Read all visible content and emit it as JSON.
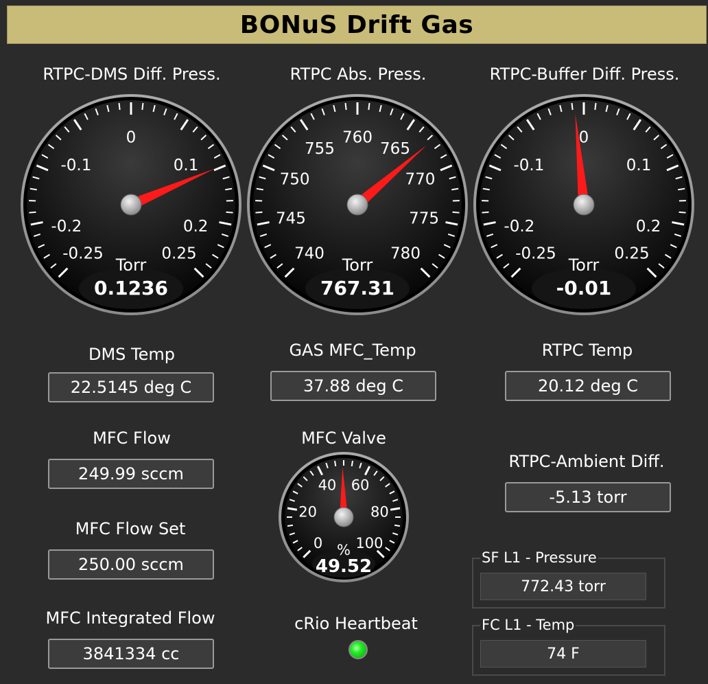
{
  "title": "BONuS Drift Gas",
  "gauges": {
    "dms": {
      "label": "RTPC-DMS Diff. Press.",
      "unit": "Torr",
      "display": "0.1236",
      "value": 0.1236,
      "ticks": [
        "-0.25",
        "-0.2",
        "-0.1",
        "0",
        "0.1",
        "0.2",
        "0.25"
      ],
      "range": [
        -0.25,
        0.25
      ],
      "tick_values": [
        -0.25,
        -0.2,
        -0.1,
        0,
        0.1,
        0.2,
        0.25
      ]
    },
    "abs": {
      "label": "RTPC Abs. Press.",
      "unit": "Torr",
      "display": "767.31",
      "value": 767.31,
      "ticks": [
        "740",
        "745",
        "750",
        "755",
        "760",
        "765",
        "770",
        "775",
        "780"
      ],
      "range": [
        740,
        780
      ],
      "tick_values": [
        740,
        745,
        750,
        755,
        760,
        765,
        770,
        775,
        780
      ]
    },
    "buffer": {
      "label": "RTPC-Buffer Diff. Press.",
      "unit": "Torr",
      "display": "-0.01",
      "value": -0.01,
      "ticks": [
        "-0.25",
        "-0.2",
        "-0.1",
        "0",
        "0.1",
        "0.2",
        "0.25"
      ],
      "range": [
        -0.25,
        0.25
      ],
      "tick_values": [
        -0.25,
        -0.2,
        -0.1,
        0,
        0.1,
        0.2,
        0.25
      ]
    },
    "valve": {
      "label": "MFC Valve",
      "unit": "%",
      "display": "49.52",
      "value": 49.52,
      "ticks": [
        "0",
        "20",
        "40",
        "60",
        "80",
        "100"
      ],
      "range": [
        0,
        100
      ],
      "tick_values": [
        0,
        20,
        40,
        60,
        80,
        100
      ]
    }
  },
  "indicators": {
    "dms_temp": {
      "label": "DMS Temp",
      "value": "22.5145 deg C"
    },
    "gas_mfc_temp": {
      "label": "GAS MFC_Temp",
      "value": "37.88 deg C"
    },
    "rtpc_temp": {
      "label": "RTPC Temp",
      "value": "20.12 deg C"
    },
    "mfc_flow": {
      "label": "MFC Flow",
      "value": "249.99 sccm"
    },
    "mfc_flow_set": {
      "label": "MFC Flow Set",
      "value": "250.00 sccm"
    },
    "mfc_integrated_flow": {
      "label": "MFC Integrated Flow",
      "value": "3841334 cc"
    },
    "rtpc_ambient_diff": {
      "label": "RTPC-Ambient Diff.",
      "value": "-5.13 torr"
    }
  },
  "groups": {
    "sf_l1": {
      "title": "SF L1 - Pressure",
      "value": "772.43 torr"
    },
    "fc_l1": {
      "title": "FC L1 - Temp",
      "value": "74 F"
    }
  },
  "heartbeat": {
    "label": "cRio Heartbeat",
    "color": "#22ee22"
  },
  "colors": {
    "title_bg": "#c8bc78",
    "needle": "#ff1a1a",
    "background": "#2b2b2b"
  }
}
